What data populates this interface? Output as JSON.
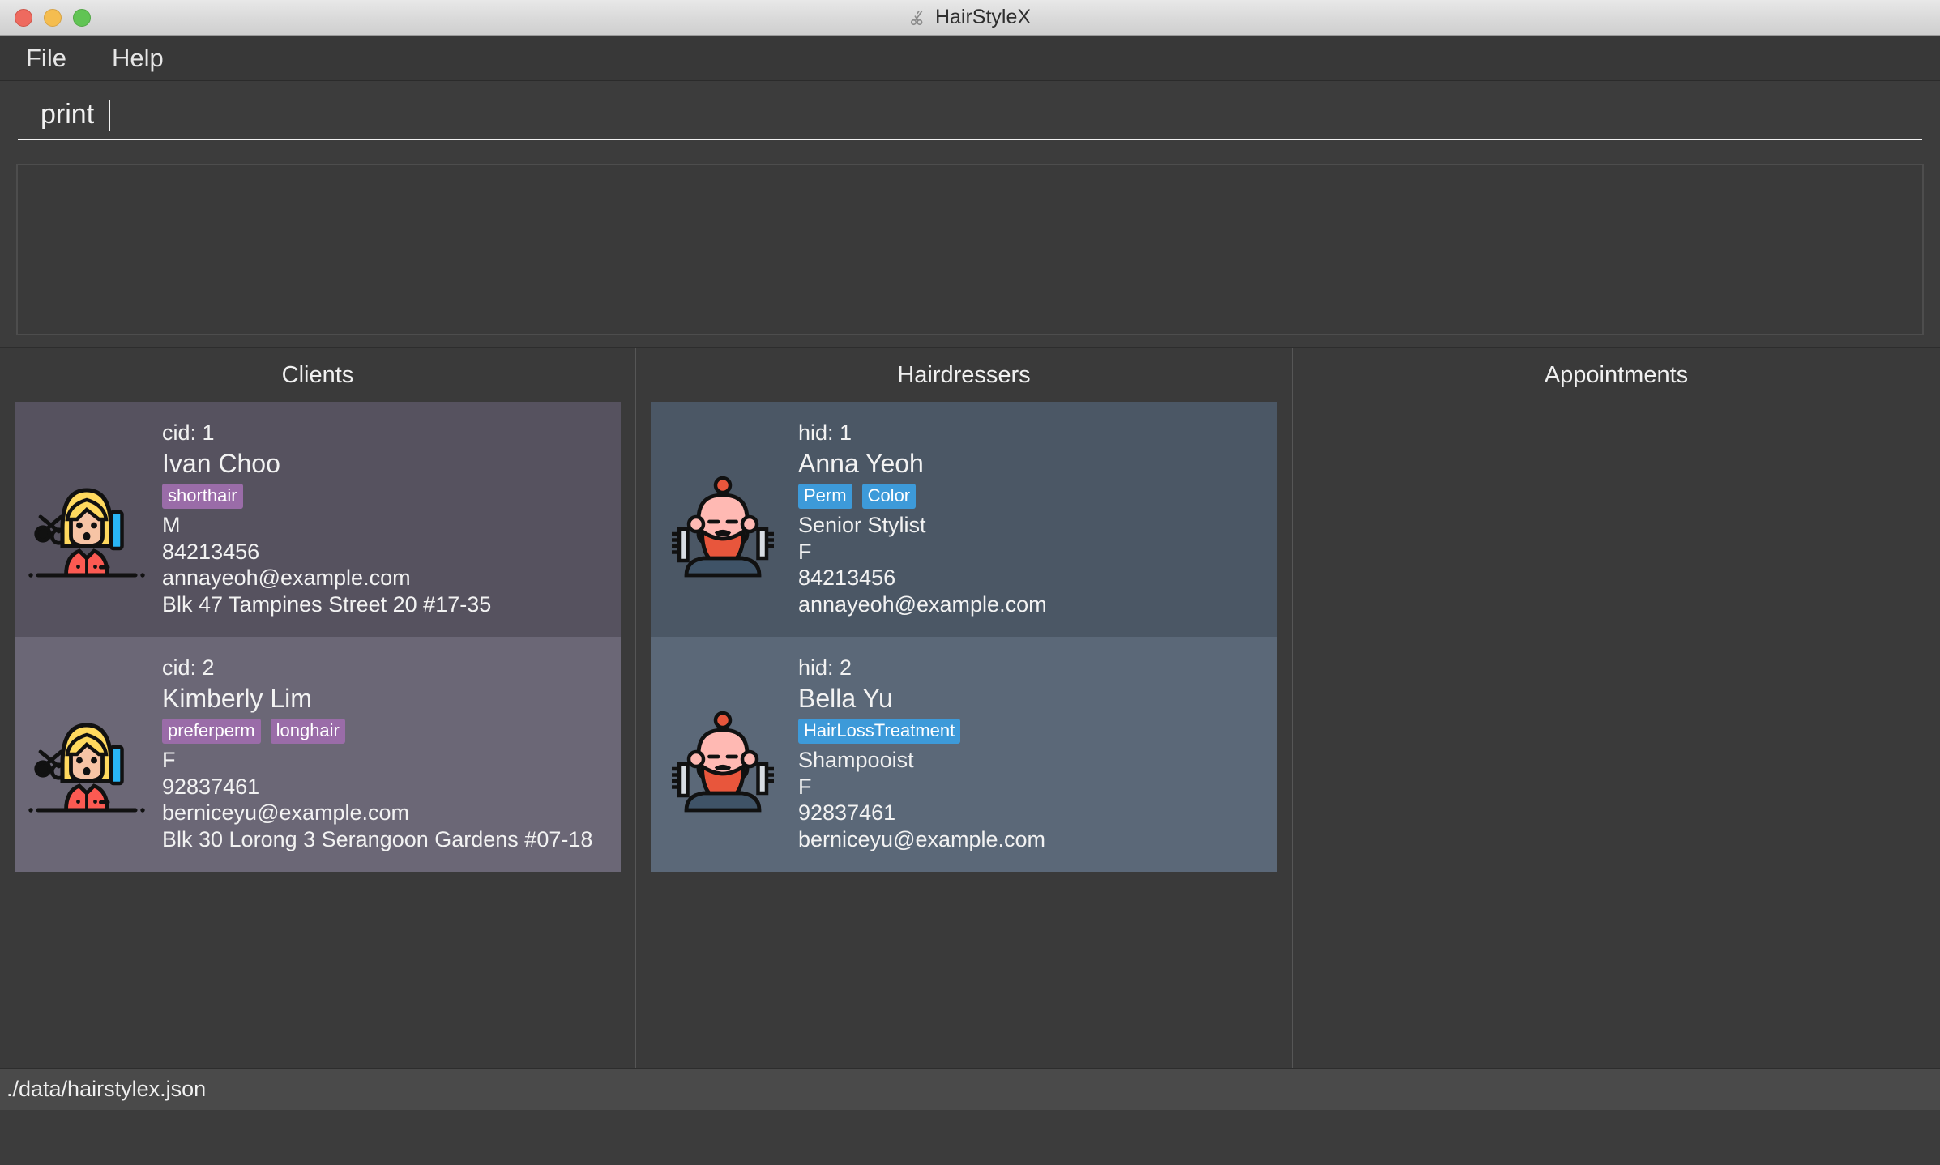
{
  "window": {
    "title": "HairStyleX",
    "title_icon": "scissors-icon",
    "traffic_lights": [
      "close",
      "minimize",
      "maximize"
    ]
  },
  "menubar": {
    "items": [
      {
        "label": "File"
      },
      {
        "label": "Help"
      }
    ]
  },
  "command": {
    "value": "print",
    "placeholder": "Enter command here..."
  },
  "result_display": {
    "text": ""
  },
  "panels": {
    "clients": {
      "title": "Clients",
      "cards": [
        {
          "id_label": "cid: 1",
          "name": "Ivan Choo",
          "tags": [
            "shorthair"
          ],
          "gender": "M",
          "phone": "84213456",
          "email": "annayeoh@example.com",
          "address": "Blk 47 Tampines Street 20 #17-35"
        },
        {
          "id_label": "cid: 2",
          "name": "Kimberly Lim",
          "tags": [
            "preferperm",
            "longhair"
          ],
          "gender": "F",
          "phone": "92837461",
          "email": "berniceyu@example.com",
          "address": "Blk 30 Lorong 3 Serangoon Gardens #07-18"
        }
      ]
    },
    "hairdressers": {
      "title": "Hairdressers",
      "cards": [
        {
          "id_label": "hid: 1",
          "name": "Anna Yeoh",
          "tags": [
            "Perm",
            "Color"
          ],
          "title_role": "Senior Stylist",
          "gender": "F",
          "phone": "84213456",
          "email": "annayeoh@example.com"
        },
        {
          "id_label": "hid: 2",
          "name": "Bella Yu",
          "tags": [
            "HairLossTreatment"
          ],
          "title_role": "Shampooist",
          "gender": "F",
          "phone": "92837461",
          "email": "berniceyu@example.com"
        }
      ]
    },
    "appointments": {
      "title": "Appointments",
      "cards": []
    }
  },
  "statusbar": {
    "save_location": "./data/hairstylex.json"
  },
  "colors": {
    "client_tag": "#9a6ca8",
    "hairdresser_tag": "#3d9ad9",
    "client_card_odd": "#56525f",
    "client_card_even": "#6b6776",
    "hairdresser_card_odd": "#4b5765",
    "hairdresser_card_even": "#5b6878",
    "window_background": "#3c3c3c",
    "text": "#f2f2f2"
  }
}
